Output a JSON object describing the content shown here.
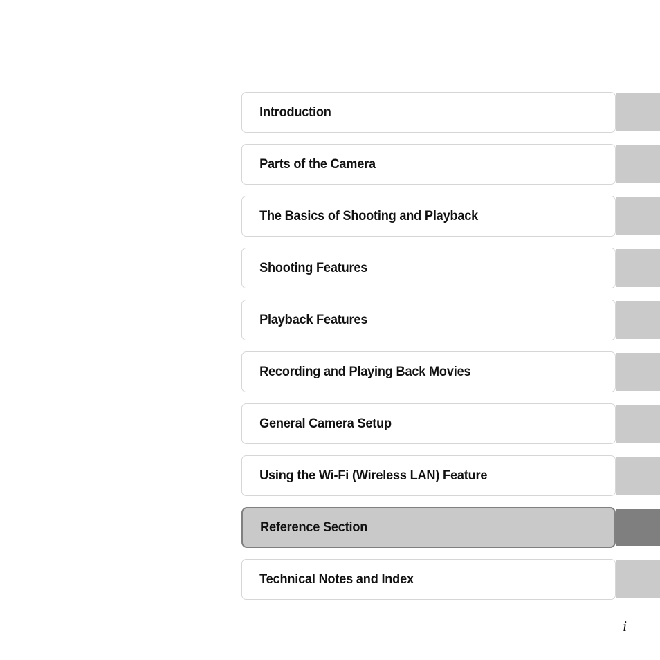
{
  "page": {
    "folio": "i",
    "colors": {
      "page_background": "#ffffff",
      "card_background": "#ffffff",
      "card_border": "#d6d6d6",
      "tab_background": "#cacaca",
      "selected_card_background": "#c9c9c9",
      "selected_card_border": "#808080",
      "selected_tab_background": "#7f7f7f",
      "title_text": "#111111"
    }
  },
  "chapter_index": {
    "chapters": [
      {
        "title": "Introduction",
        "selected": false
      },
      {
        "title": "Parts of the Camera",
        "selected": false
      },
      {
        "title": "The Basics of Shooting and Playback",
        "selected": false
      },
      {
        "title": "Shooting Features",
        "selected": false
      },
      {
        "title": "Playback Features",
        "selected": false
      },
      {
        "title": "Recording and Playing Back Movies",
        "selected": false
      },
      {
        "title": "General Camera Setup",
        "selected": false
      },
      {
        "title": "Using the Wi-Fi (Wireless LAN) Feature",
        "selected": false
      },
      {
        "title": "Reference Section",
        "selected": true
      },
      {
        "title": "Technical Notes and Index",
        "selected": false
      }
    ]
  }
}
